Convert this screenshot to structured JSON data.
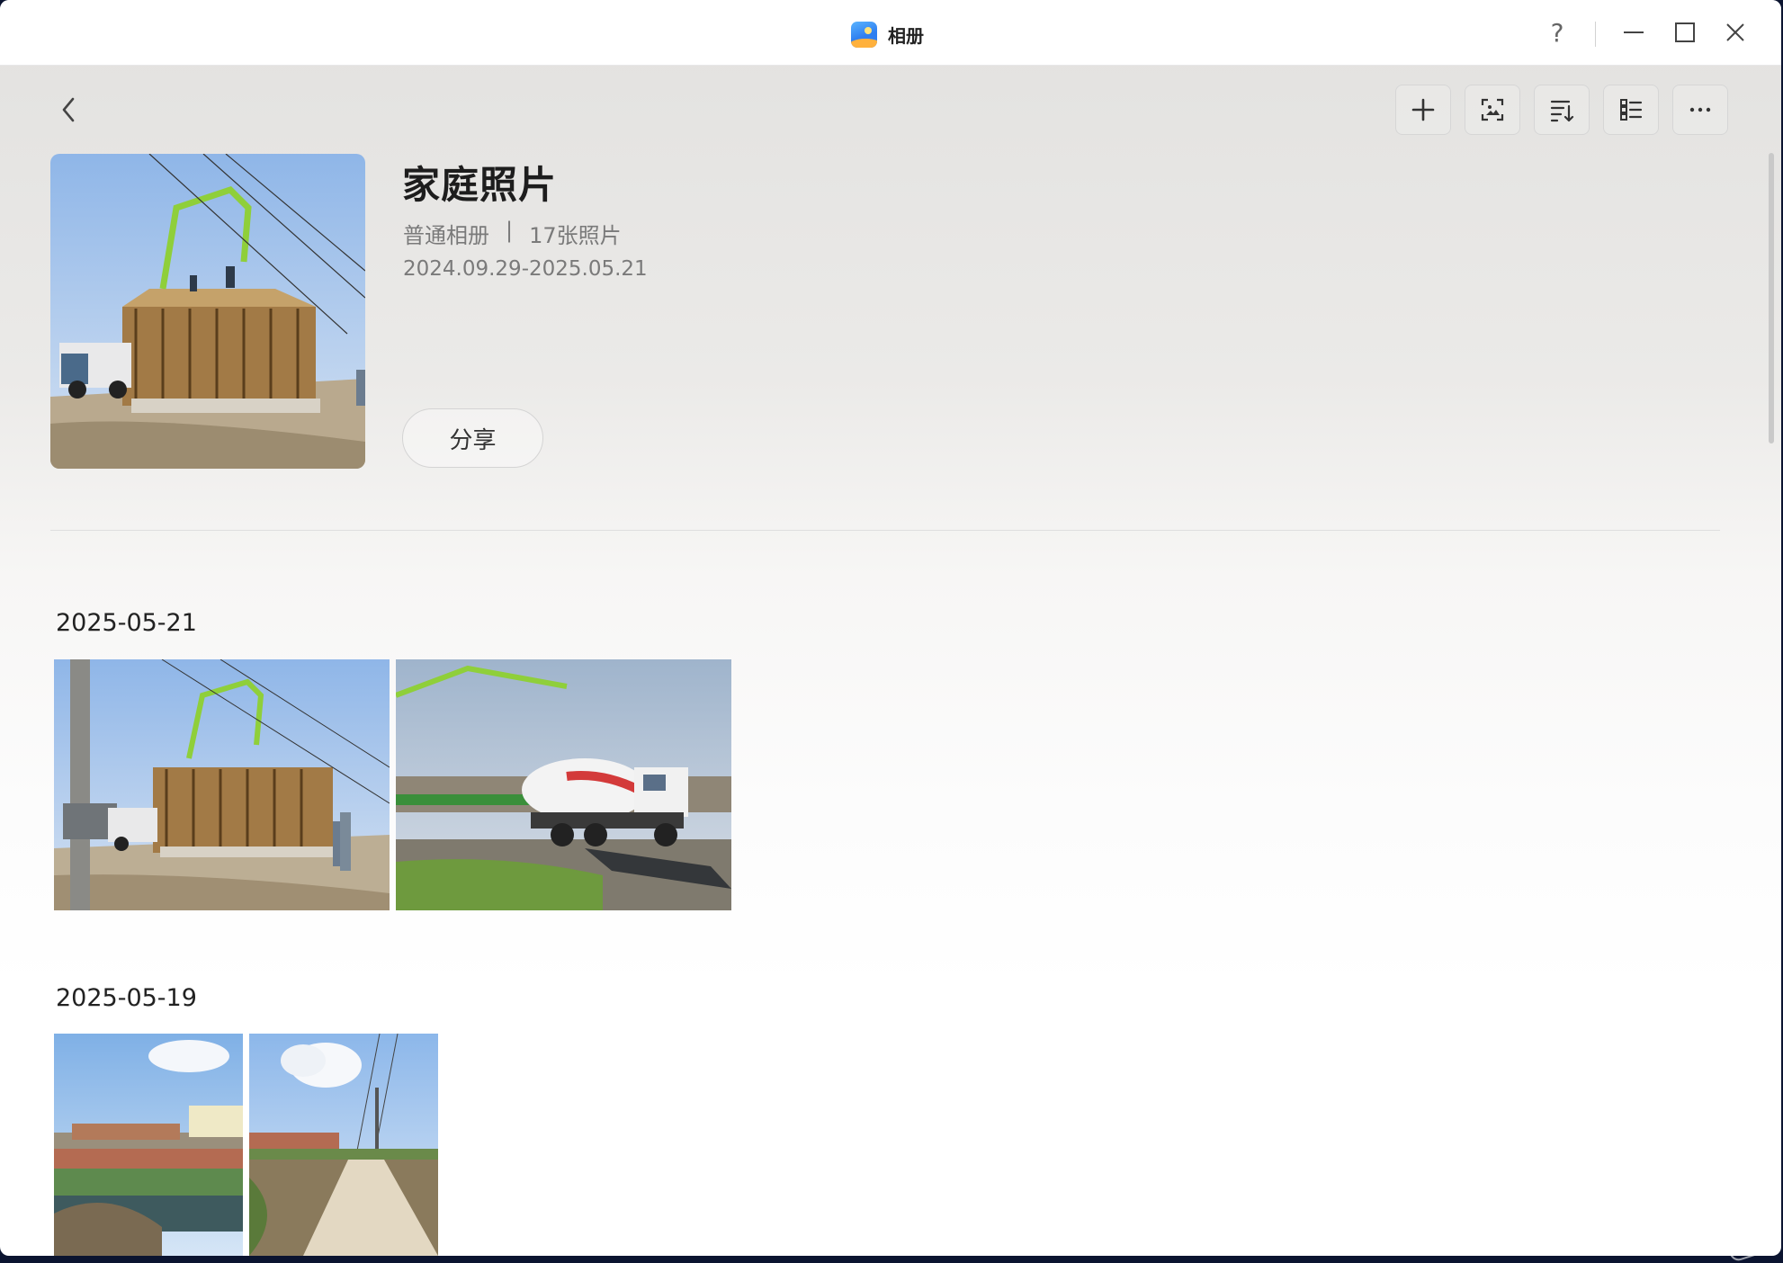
{
  "window": {
    "app_name": "相册",
    "help_label": "?",
    "controls": [
      "help-icon",
      "minimize-icon",
      "maximize-icon",
      "close-icon"
    ]
  },
  "toolbar": {
    "back": "chevron-left-icon",
    "actions": [
      {
        "name": "add-button",
        "icon": "plus-icon"
      },
      {
        "name": "image-search-button",
        "icon": "scan-image-icon"
      },
      {
        "name": "sort-button",
        "icon": "sort-icon"
      },
      {
        "name": "view-mode-button",
        "icon": "list-view-icon"
      },
      {
        "name": "more-button",
        "icon": "more-horizontal-icon"
      }
    ]
  },
  "album": {
    "title": "家庭照片",
    "type": "普通相册",
    "separator": "|",
    "count": "17张照片",
    "date_range": "2024.09.29-2025.05.21",
    "share_label": "分享"
  },
  "groups": [
    {
      "date": "2025-05-21",
      "photos": [
        "construction-site-pump-truck",
        "cement-mixer-truck"
      ]
    },
    {
      "date": "2025-05-19",
      "photos": [
        "river-bank-village",
        "country-road-power-lines"
      ]
    }
  ],
  "colors": {
    "accent": "#2f7ff0",
    "text_primary": "#1d1d1d",
    "text_secondary": "#7a7a7a"
  }
}
